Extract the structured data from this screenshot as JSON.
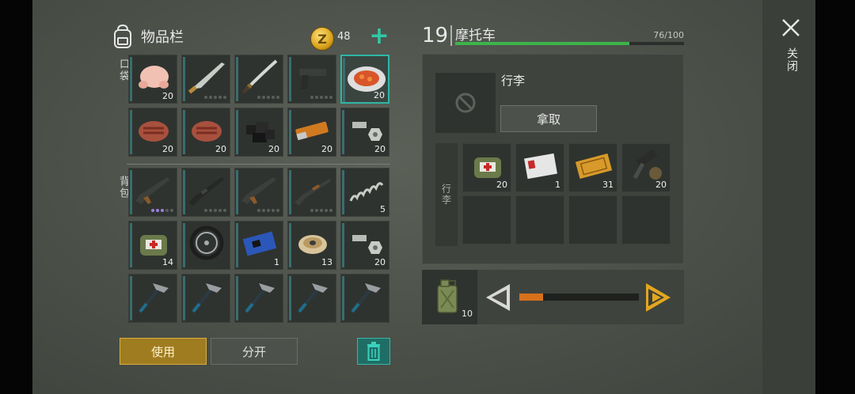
{
  "inventory": {
    "title": "物品栏",
    "coins": "48",
    "pocket_label": "口袋",
    "backpack_label": "背包",
    "pocket_slots": [
      {
        "icon": "raw-chicken-icon",
        "qty": "20"
      },
      {
        "icon": "machete-icon",
        "qty": "",
        "level": 0
      },
      {
        "icon": "katana-icon",
        "qty": "",
        "level": 0
      },
      {
        "icon": "pistol-icon",
        "qty": "",
        "level": 0
      },
      {
        "icon": "stew-plate-icon",
        "qty": "20",
        "selected": true
      },
      {
        "icon": "raw-steak-icon",
        "qty": "20"
      },
      {
        "icon": "raw-steak-icon",
        "qty": "20"
      },
      {
        "icon": "coal-icon",
        "qty": "20"
      },
      {
        "icon": "battery-cell-icon",
        "qty": "20"
      },
      {
        "icon": "bolt-nut-icon",
        "qty": "20"
      }
    ],
    "backpack_slots": [
      {
        "icon": "ak-rifle-icon",
        "qty": "",
        "level": 3
      },
      {
        "icon": "m16-rifle-icon",
        "qty": "",
        "level": 0
      },
      {
        "icon": "ak-rifle-icon",
        "qty": "",
        "level": 0
      },
      {
        "icon": "shotgun-icon",
        "qty": "",
        "level": 0
      },
      {
        "icon": "spring-icon",
        "qty": "5"
      },
      {
        "icon": "medkit-bag-icon",
        "qty": "14"
      },
      {
        "icon": "wheel-icon",
        "qty": ""
      },
      {
        "icon": "circuit-board-icon",
        "qty": "1"
      },
      {
        "icon": "wire-spool-icon",
        "qty": "13"
      },
      {
        "icon": "bolt-nut-icon",
        "qty": "20"
      },
      {
        "icon": "pickaxe-icon",
        "qty": ""
      },
      {
        "icon": "pickaxe-icon",
        "qty": ""
      },
      {
        "icon": "pickaxe-icon",
        "qty": ""
      },
      {
        "icon": "pickaxe-icon",
        "qty": ""
      },
      {
        "icon": "pickaxe-icon",
        "qty": ""
      }
    ],
    "use_label": "使用",
    "split_label": "分开"
  },
  "vehicle": {
    "level": "19",
    "name": "摩托车",
    "hp_text": "76/100",
    "hp_fraction": 0.76,
    "luggage_label": "行李",
    "take_label": "拿取",
    "luggage_side_label": "行李",
    "luggage_slots": [
      {
        "icon": "medkit-bag-icon",
        "qty": "20"
      },
      {
        "icon": "army-id-card-icon",
        "qty": "1"
      },
      {
        "icon": "coupon-ticket-icon",
        "qty": "31"
      },
      {
        "icon": "engine-parts-icon",
        "qty": "20"
      },
      {
        "icon": "",
        "qty": ""
      },
      {
        "icon": "",
        "qty": ""
      },
      {
        "icon": "",
        "qty": ""
      },
      {
        "icon": "",
        "qty": ""
      }
    ],
    "fuel_qty": "10",
    "fuel_fraction": 0.2
  },
  "close_label": "关闭",
  "colors": {
    "accent": "#2fb7a7",
    "gold": "#a07c21",
    "hp": "#3cb44b",
    "fuel": "#d7711c"
  }
}
